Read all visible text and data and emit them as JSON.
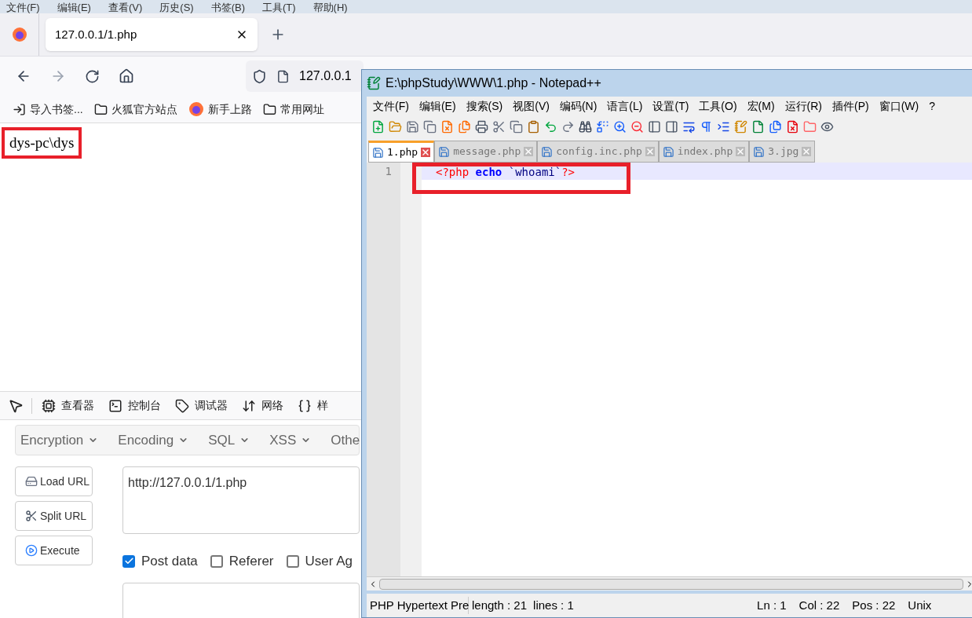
{
  "browser": {
    "menu": [
      "文件(F)",
      "编辑(E)",
      "查看(V)",
      "历史(S)",
      "书签(B)",
      "工具(T)",
      "帮助(H)"
    ],
    "tab": {
      "title": "127.0.0.1/1.php"
    },
    "address": "127.0.0.1",
    "bookmarks": [
      {
        "label": "导入书签...",
        "kind": "import"
      },
      {
        "label": "火狐官方站点",
        "kind": "folder"
      },
      {
        "label": "新手上路",
        "kind": "firefox"
      },
      {
        "label": "常用网址",
        "kind": "folder"
      }
    ],
    "page_text": "dys-pc\\dys",
    "devtools": {
      "tabs": [
        {
          "label": "查看器",
          "kind": "inspector"
        },
        {
          "label": "控制台",
          "kind": "console"
        },
        {
          "label": "调试器",
          "kind": "debugger"
        },
        {
          "label": "网络",
          "kind": "network"
        },
        {
          "label": "样",
          "kind": "style"
        }
      ]
    },
    "hackbar": {
      "menus": [
        "Encryption",
        "Encoding",
        "SQL",
        "XSS",
        "Othe"
      ],
      "buttons": [
        {
          "label": "Load URL",
          "kind": "load"
        },
        {
          "label": "Split URL",
          "kind": "split"
        },
        {
          "label": "Execute",
          "kind": "execute"
        }
      ],
      "url": "http://127.0.0.1/1.php",
      "options": [
        {
          "label": "Post data",
          "checked": true
        },
        {
          "label": "Referer",
          "checked": false
        },
        {
          "label": "User Ag",
          "checked": false
        }
      ]
    }
  },
  "notepad": {
    "title": "E:\\phpStudy\\WWW\\1.php - Notepad++",
    "menu": [
      "文件(F)",
      "编辑(E)",
      "搜索(S)",
      "视图(V)",
      "编码(N)",
      "语言(L)",
      "设置(T)",
      "工具(O)",
      "宏(M)",
      "运行(R)",
      "插件(P)",
      "窗口(W)",
      "?"
    ],
    "tabs": [
      {
        "label": "1.php",
        "selected": true
      },
      {
        "label": "message.php",
        "selected": false
      },
      {
        "label": "config.inc.php",
        "selected": false
      },
      {
        "label": "index.php",
        "selected": false
      },
      {
        "label": "3.jpg",
        "selected": false
      }
    ],
    "lines": [
      {
        "number": "1",
        "current": true,
        "tokens": [
          {
            "text": "<?php ",
            "kind": "tag"
          },
          {
            "text": "echo ",
            "kind": "keyword"
          },
          {
            "text": "`whoami`",
            "kind": "string"
          },
          {
            "text": "?>",
            "kind": "tag"
          }
        ]
      }
    ],
    "status": [
      "PHP Hypertext Pre",
      "length : 21",
      "lines : 1",
      "Ln : 1",
      "Col : 22",
      "Pos : 22",
      "Unix"
    ]
  }
}
